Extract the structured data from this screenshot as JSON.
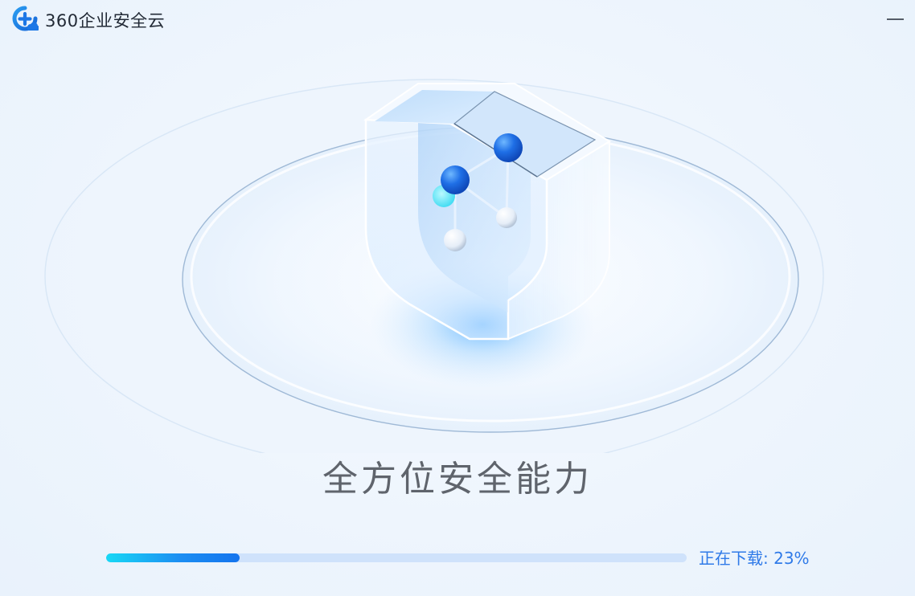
{
  "window": {
    "title": "360企业安全云",
    "minimize_icon": "minimize-icon",
    "logo_icon": "cloud-plus-logo"
  },
  "hero": {
    "headline": "全方位安全能力",
    "illustration": "glass-shield-with-molecule"
  },
  "progress": {
    "label": "正在下载: 23%",
    "percent": 23
  },
  "colors": {
    "accent": "#2f7ae8",
    "progress_start": "#18d8f5",
    "progress_end": "#1474ee",
    "track": "#cfe2fb"
  }
}
